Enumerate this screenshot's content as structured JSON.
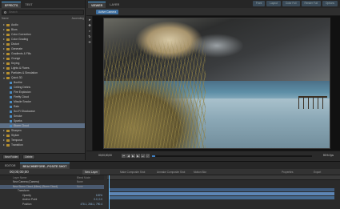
{
  "effects_panel": {
    "tabs": [
      {
        "label": "EFFECTS"
      },
      {
        "label": "TEXT"
      }
    ],
    "search_placeholder": "Search",
    "col_name": "Name",
    "col_sort": "Ascending",
    "categories": [
      {
        "label": "Audio"
      },
      {
        "label": "Blurs"
      },
      {
        "label": "Color Correction"
      },
      {
        "label": "Color Grading"
      },
      {
        "label": "Distort"
      },
      {
        "label": "Generate"
      },
      {
        "label": "Gradients & Fills"
      },
      {
        "label": "Grunge"
      },
      {
        "label": "Keying"
      },
      {
        "label": "Lights & Flares"
      },
      {
        "label": "Particles & Simulation"
      },
      {
        "label": "Quick 3D"
      }
    ],
    "quick3d_items": [
      {
        "label": "Bonfire"
      },
      {
        "label": "Ceiling Debris"
      },
      {
        "label": "Fire Explosion"
      },
      {
        "label": "Firefly Cloud"
      },
      {
        "label": "Missile Smoke"
      },
      {
        "label": "Rain"
      },
      {
        "label": "Sci-Fi Shockwave"
      },
      {
        "label": "Smoke"
      },
      {
        "label": "Sparks"
      },
      {
        "label": "Storm Cloud"
      }
    ],
    "categories_after": [
      {
        "label": "Sharpen"
      },
      {
        "label": "Stylize"
      },
      {
        "label": "Temporal"
      },
      {
        "label": "Transition"
      }
    ],
    "footer_new_folder": "New Folder",
    "footer_delete": "Delete"
  },
  "viewer_panel": {
    "tabs": [
      {
        "label": "VIEWER"
      },
      {
        "label": "LAYER"
      }
    ],
    "right_controls": [
      "Front",
      "Layout",
      "Color Full",
      "Render Full",
      "Options"
    ],
    "camera_select": "Active Camera",
    "timecode": "00;00;00;00",
    "scrub_progress": 0.02,
    "fps_readout": "59.94 fps",
    "zoom": "70.6%"
  },
  "editor_panel": {
    "tabs": [
      {
        "label": "EDITOR"
      },
      {
        "label": "BEACHBEFORE...POSITE SHOT"
      }
    ],
    "timecode": "00;00;00;00",
    "new_layer": "New Layer",
    "tools": [
      "Make Composite Shot",
      "Unmake Composite Shot",
      "Motion Blur",
      "Properties",
      "Export"
    ],
    "columns": {
      "name": "Layer Name",
      "blend": "Blend Mode"
    },
    "layers": [
      {
        "name": "New Camera (Camera)",
        "mode": "None"
      },
      {
        "name": "New Storm Cloud (Mbro) (Storm Cloud)",
        "mode": "None"
      },
      {
        "name": "Transform",
        "mode": ""
      },
      {
        "name": "Opacity",
        "mode": "",
        "value": "100%"
      },
      {
        "name": "Anchor Point",
        "mode": "",
        "value": "0.0, 0.0"
      },
      {
        "name": "Position",
        "mode": "",
        "value": "476.1, 266.1, 790.4"
      }
    ]
  },
  "colors": {
    "accent": "#3e7ec0",
    "selection": "#5d6f86"
  }
}
